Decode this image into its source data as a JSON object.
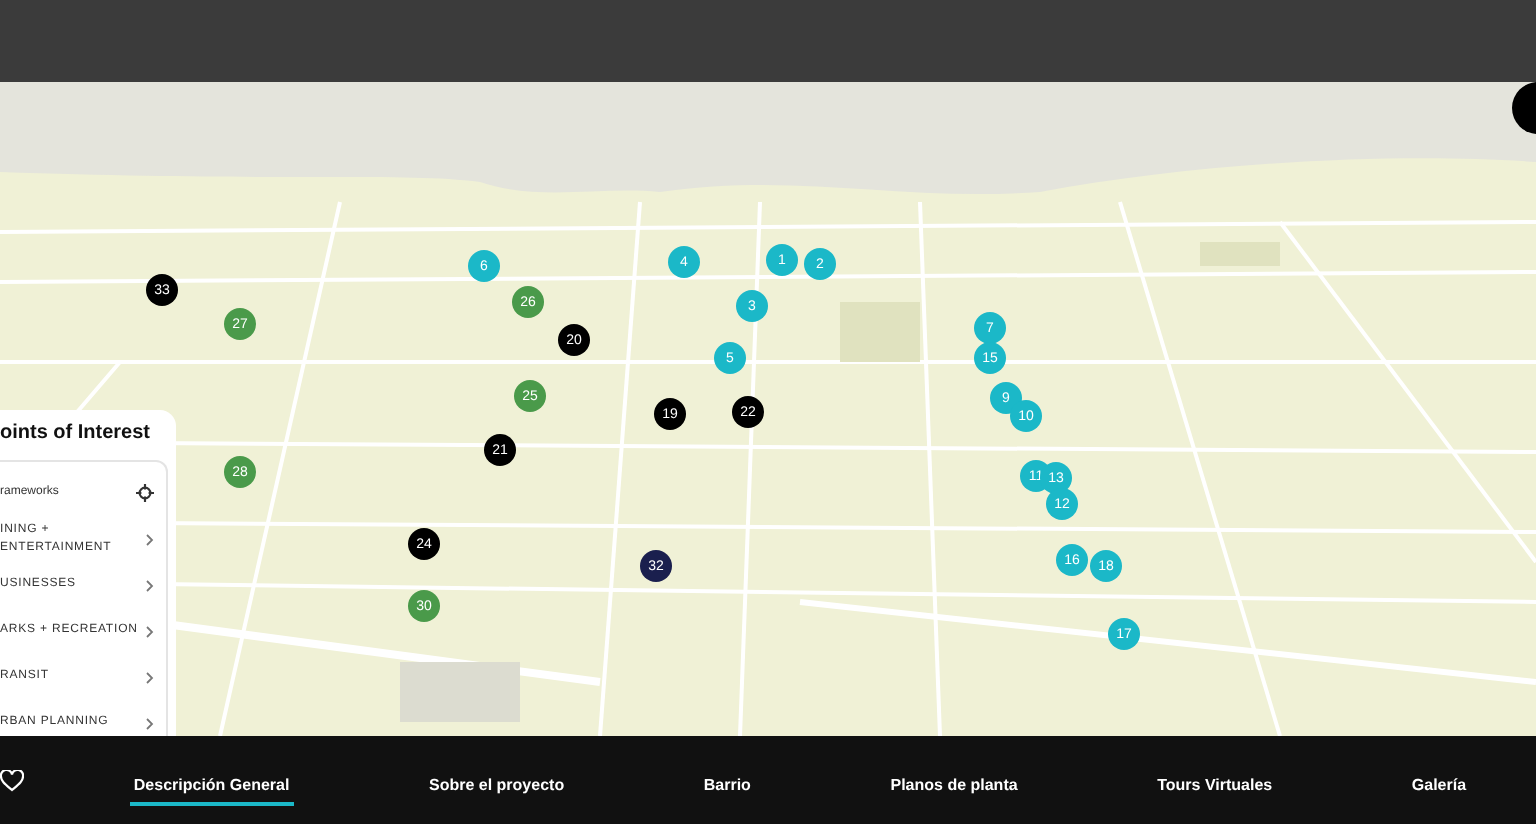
{
  "map": {
    "markers": [
      {
        "label": "1",
        "color": "#1bb8c8"
      },
      {
        "label": "2",
        "color": "#1bb8c8"
      },
      {
        "label": "3",
        "color": "#1bb8c8"
      },
      {
        "label": "4",
        "color": "#1bb8c8"
      },
      {
        "label": "5",
        "color": "#1bb8c8"
      },
      {
        "label": "6",
        "color": "#1bb8c8"
      },
      {
        "label": "7",
        "color": "#1bb8c8"
      },
      {
        "label": "9",
        "color": "#1bb8c8"
      },
      {
        "label": "10",
        "color": "#1bb8c8"
      },
      {
        "label": "11",
        "color": "#1bb8c8"
      },
      {
        "label": "13",
        "color": "#1bb8c8"
      },
      {
        "label": "12",
        "color": "#1bb8c8"
      },
      {
        "label": "15",
        "color": "#1bb8c8"
      },
      {
        "label": "16",
        "color": "#1bb8c8"
      },
      {
        "label": "17",
        "color": "#1bb8c8"
      },
      {
        "label": "18",
        "color": "#1bb8c8"
      },
      {
        "label": "19",
        "color": "#000000"
      },
      {
        "label": "20",
        "color": "#000000"
      },
      {
        "label": "21",
        "color": "#000000"
      },
      {
        "label": "22",
        "color": "#000000"
      },
      {
        "label": "24",
        "color": "#000000"
      },
      {
        "label": "25",
        "color": "#4a9a4a"
      },
      {
        "label": "26",
        "color": "#4a9a4a"
      },
      {
        "label": "27",
        "color": "#4a9a4a"
      },
      {
        "label": "28",
        "color": "#4a9a4a"
      },
      {
        "label": "30",
        "color": "#4a9a4a"
      },
      {
        "label": "32",
        "color": "#1a1f4e"
      },
      {
        "label": "33",
        "color": "#000000"
      }
    ]
  },
  "poi_panel": {
    "title": "oints of Interest",
    "items": [
      {
        "label": "rameworks",
        "kind": "toggle"
      },
      {
        "label": "INING + ENTERTAINMENT",
        "kind": "category"
      },
      {
        "label": "USINESSES",
        "kind": "category"
      },
      {
        "label": "ARKS + RECREATION",
        "kind": "category"
      },
      {
        "label": "RANSIT",
        "kind": "category"
      },
      {
        "label": "RBAN PLANNING",
        "kind": "category"
      }
    ]
  },
  "nav": {
    "tabs": [
      {
        "label": "Descripción General",
        "selected": true
      },
      {
        "label": "Sobre el proyecto",
        "selected": false
      },
      {
        "label": "Barrio",
        "selected": false
      },
      {
        "label": "Planos de planta",
        "selected": false
      },
      {
        "label": "Tours Virtuales",
        "selected": false
      },
      {
        "label": "Galería",
        "selected": false
      }
    ]
  }
}
